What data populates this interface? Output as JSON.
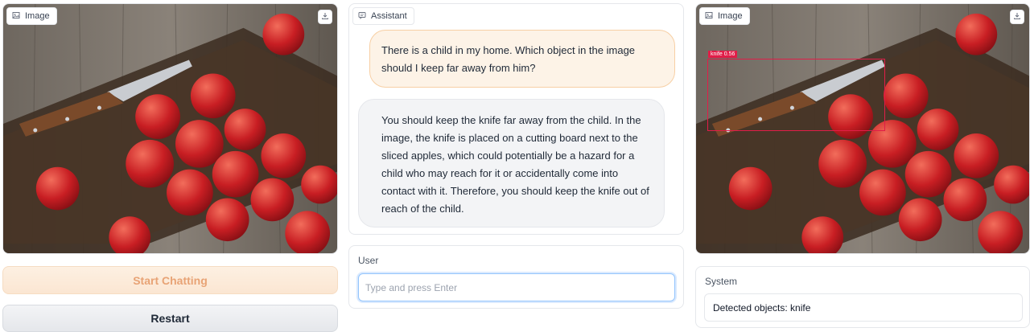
{
  "left_image": {
    "label": "Image",
    "icon": "image-icon",
    "download_icon": "download-icon"
  },
  "right_image": {
    "label": "Image",
    "icon": "image-icon",
    "download_icon": "download-icon",
    "detection": {
      "label": "knife 0.56"
    }
  },
  "buttons": {
    "start": "Start Chatting",
    "restart": "Restart"
  },
  "assistant": {
    "label": "Assistant",
    "icon": "chat-icon",
    "messages": [
      {
        "role": "user",
        "text": "There is a child in my home. Which object in the image should I keep far away from him?"
      },
      {
        "role": "assistant",
        "text": "You should keep the knife far away from the child. In the image, the knife is placed on a cutting board next to the sliced apples, which could potentially be a hazard for a child who may reach for it or accidentally come into contact with it. Therefore, you should keep the knife out of reach of the child."
      }
    ]
  },
  "user": {
    "label": "User",
    "placeholder": "Type and press Enter",
    "value": ""
  },
  "system": {
    "label": "System",
    "value": "Detected objects: knife"
  },
  "colors": {
    "accent": "#f97316",
    "detection": "#e11d48",
    "focus": "#93c5fd"
  }
}
